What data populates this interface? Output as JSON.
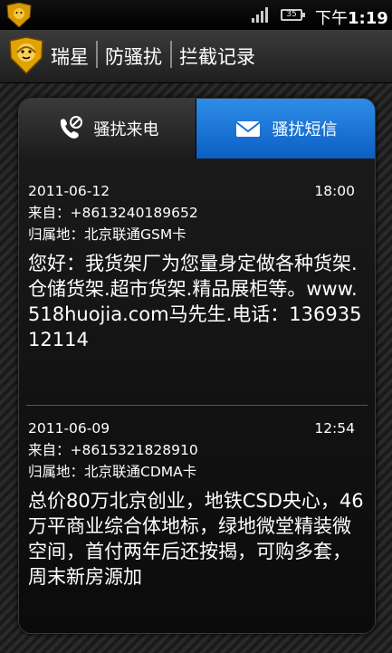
{
  "status": {
    "battery": "35",
    "time_prefix": "下午",
    "time": "1:19"
  },
  "title": {
    "app_name": "瑞星",
    "section": "防骚扰",
    "page": "拦截记录"
  },
  "tabs": [
    {
      "label": "骚扰来电",
      "active": false
    },
    {
      "label": "骚扰短信",
      "active": true
    }
  ],
  "messages": [
    {
      "date": "2011-06-12",
      "time": "18:00",
      "from": "来自：+8613240189652",
      "location": "归属地：北京联通GSM卡",
      "body": "您好：我货架厂为您量身定做各种货架.仓储货架.超市货架.精品展柜等。www.518huojia.com马先生.电话：13693512114"
    },
    {
      "date": "2011-06-09",
      "time": "12:54",
      "from": "来自：+8615321828910",
      "location": "归属地：北京联通CDMA卡",
      "body": "总价80万北京创业，地铁CSD央心，46万平商业综合体地标，绿地微堂精装微空间，首付两年后还按揭，可购多套，周末新房源加"
    }
  ],
  "colors": {
    "accent": "#1a75d8",
    "logo": "#f0b400"
  }
}
